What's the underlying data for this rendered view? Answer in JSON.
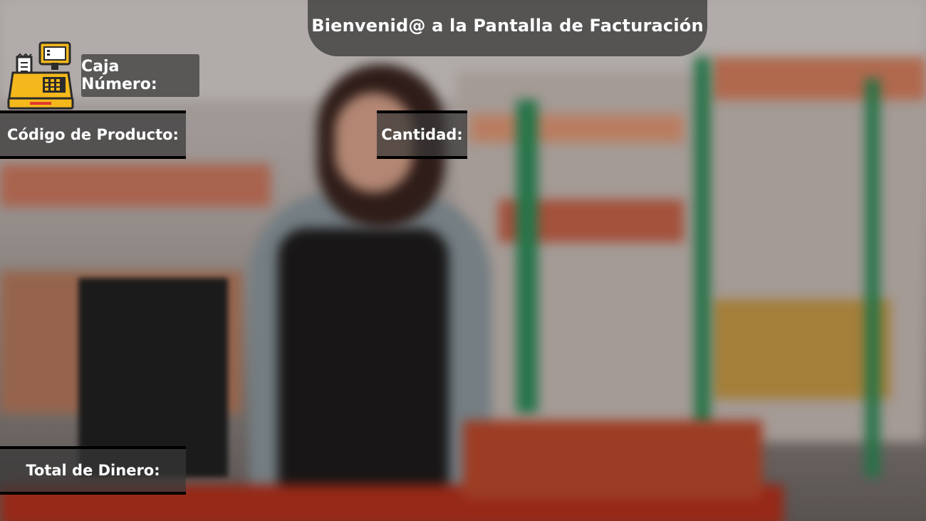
{
  "header": {
    "title": "Bienvenid@ a la Pantalla de Facturación"
  },
  "labels": {
    "caja_numero": "Caja Número:",
    "codigo_producto": "Código de Producto:",
    "cantidad": "Cantidad:",
    "total_dinero": "Total de Dinero:"
  },
  "icons": {
    "register": "cash-register-icon"
  },
  "colors": {
    "header_bg": "#323232",
    "label_bg": "#373737",
    "text": "#ffffff",
    "register_yellow": "#f5b81c",
    "register_dark": "#2b2b2b"
  }
}
